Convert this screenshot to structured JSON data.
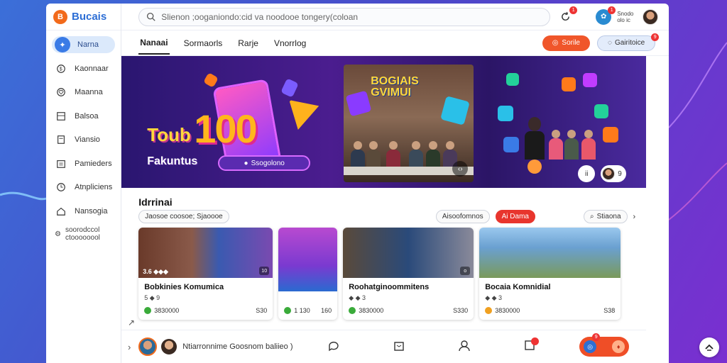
{
  "app": {
    "brand_name": "Bucais",
    "brand_logo_letter": "B"
  },
  "sidebar": {
    "items": [
      {
        "label": "Narna",
        "icon": "star-icon",
        "active": true
      },
      {
        "label": "Kaonnaar",
        "icon": "dollar-icon"
      },
      {
        "label": "Maanna",
        "icon": "heart-icon"
      },
      {
        "label": "Balsoa",
        "icon": "grid-icon"
      },
      {
        "label": "Viansio",
        "icon": "page-icon"
      },
      {
        "label": "Pamieders",
        "icon": "calendar-icon"
      },
      {
        "label": "Atnpliciens",
        "icon": "clock-icon"
      },
      {
        "label": "Nansogia",
        "icon": "home-icon"
      }
    ],
    "more_label": "soorodccol ctoooooool"
  },
  "topbar": {
    "search_placeholder": "Slienon ;ooganiondo:cid va noodooe tongery(coloan",
    "notif_badge": "1",
    "user_badge": "1",
    "user_text": "Snodo olo ic"
  },
  "tabs": [
    {
      "label": "Nanaai",
      "active": true
    },
    {
      "label": "Sormaorls"
    },
    {
      "label": "Rarje"
    },
    {
      "label": "Vnorrlog"
    }
  ],
  "actions": {
    "primary_label": "Sorile",
    "secondary_label": "Gairitoice",
    "secondary_badge": "9"
  },
  "banner": {
    "title": "Toub",
    "big_number": "100",
    "subtitle": "Fakuntus",
    "pill_label": "Ssogolono",
    "photo_sign_line1": "BOGIAIS",
    "photo_sign_line2": "GVIMUI",
    "photo_ctrl": "&lt;&gt;",
    "dot_left": "ii",
    "dot_count": "9"
  },
  "section": {
    "title": "Idrrinai",
    "filter_chip": "Jaosoe coosoe; Sjaoooe",
    "chip_1": "Aisoofomnos",
    "chip_2": "Ai Dama",
    "chip_3": "Stiaona",
    "chevron": "›"
  },
  "cards": [
    {
      "title": "Bobkinies Komumica",
      "meta": "5 ◆ 9",
      "img_label": "3.6 ◆◆◆",
      "corner": "10",
      "foot_left": "3830000",
      "foot_right": "S30",
      "foot_color": "#3aab3a"
    },
    {
      "title": "",
      "meta": "",
      "img_label": "",
      "corner": "",
      "foot_left": "1 130",
      "foot_right": "160",
      "foot_color": "#3aab3a"
    },
    {
      "title": "Roohatginoommitens",
      "meta": "◆ ◆ 3",
      "img_label": "",
      "corner": "o",
      "foot_left": "3830000",
      "foot_right": "S330",
      "foot_color": "#3aab3a"
    },
    {
      "title": "Bocaia Komnidial",
      "meta": "◆ ◆ 3",
      "img_label": "",
      "corner": "",
      "foot_left": "3830000",
      "foot_right": "S38",
      "foot_color": "#f0a020"
    }
  ],
  "bottom": {
    "text": "Ntiarronnime Goosnom baliieo )",
    "pill_left": "◎",
    "pill_right": "♦",
    "pill_badge": "9"
  },
  "colors": {
    "accent": "#f0562a",
    "brand": "#2c6ed5",
    "nav_active_bg": "#dbe9fb",
    "red_chip": "#e8352d"
  }
}
